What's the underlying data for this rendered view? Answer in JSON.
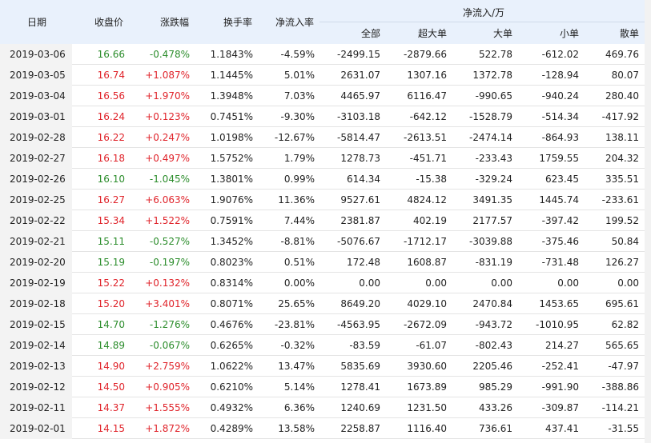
{
  "header": {
    "date": "日期",
    "close": "收盘价",
    "change": "涨跌幅",
    "turnover": "换手率",
    "net_rate": "净流入率",
    "net_group": "净流入/万",
    "all": "全部",
    "xl": "超大单",
    "large": "大单",
    "small": "小单",
    "retail": "散单",
    "sort_icon": "sort-down-arrow-icon"
  },
  "colors": {
    "up": "#e0242b",
    "down": "#2c8d2c",
    "header_bg": "#e9f1fc"
  },
  "rows": [
    {
      "date": "2019-03-06",
      "close": "16.66",
      "chg": "-0.478%",
      "turn": "1.1843%",
      "rate": "-4.59%",
      "all": "-2499.15",
      "xl": "-2879.66",
      "l": "522.78",
      "s": "-612.02",
      "r": "469.76",
      "dir": "down"
    },
    {
      "date": "2019-03-05",
      "close": "16.74",
      "chg": "+1.087%",
      "turn": "1.1445%",
      "rate": "5.01%",
      "all": "2631.07",
      "xl": "1307.16",
      "l": "1372.78",
      "s": "-128.94",
      "r": "80.07",
      "dir": "up"
    },
    {
      "date": "2019-03-04",
      "close": "16.56",
      "chg": "+1.970%",
      "turn": "1.3948%",
      "rate": "7.03%",
      "all": "4465.97",
      "xl": "6116.47",
      "l": "-990.65",
      "s": "-940.24",
      "r": "280.40",
      "dir": "up"
    },
    {
      "date": "2019-03-01",
      "close": "16.24",
      "chg": "+0.123%",
      "turn": "0.7451%",
      "rate": "-9.30%",
      "all": "-3103.18",
      "xl": "-642.12",
      "l": "-1528.79",
      "s": "-514.34",
      "r": "-417.92",
      "dir": "up"
    },
    {
      "date": "2019-02-28",
      "close": "16.22",
      "chg": "+0.247%",
      "turn": "1.0198%",
      "rate": "-12.67%",
      "all": "-5814.47",
      "xl": "-2613.51",
      "l": "-2474.14",
      "s": "-864.93",
      "r": "138.11",
      "dir": "up"
    },
    {
      "date": "2019-02-27",
      "close": "16.18",
      "chg": "+0.497%",
      "turn": "1.5752%",
      "rate": "1.79%",
      "all": "1278.73",
      "xl": "-451.71",
      "l": "-233.43",
      "s": "1759.55",
      "r": "204.32",
      "dir": "up"
    },
    {
      "date": "2019-02-26",
      "close": "16.10",
      "chg": "-1.045%",
      "turn": "1.3801%",
      "rate": "0.99%",
      "all": "614.34",
      "xl": "-15.38",
      "l": "-329.24",
      "s": "623.45",
      "r": "335.51",
      "dir": "down"
    },
    {
      "date": "2019-02-25",
      "close": "16.27",
      "chg": "+6.063%",
      "turn": "1.9076%",
      "rate": "11.36%",
      "all": "9527.61",
      "xl": "4824.12",
      "l": "3491.35",
      "s": "1445.74",
      "r": "-233.61",
      "dir": "up"
    },
    {
      "date": "2019-02-22",
      "close": "15.34",
      "chg": "+1.522%",
      "turn": "0.7591%",
      "rate": "7.44%",
      "all": "2381.87",
      "xl": "402.19",
      "l": "2177.57",
      "s": "-397.42",
      "r": "199.52",
      "dir": "up"
    },
    {
      "date": "2019-02-21",
      "close": "15.11",
      "chg": "-0.527%",
      "turn": "1.3452%",
      "rate": "-8.81%",
      "all": "-5076.67",
      "xl": "-1712.17",
      "l": "-3039.88",
      "s": "-375.46",
      "r": "50.84",
      "dir": "down"
    },
    {
      "date": "2019-02-20",
      "close": "15.19",
      "chg": "-0.197%",
      "turn": "0.8023%",
      "rate": "0.51%",
      "all": "172.48",
      "xl": "1608.87",
      "l": "-831.19",
      "s": "-731.48",
      "r": "126.27",
      "dir": "down"
    },
    {
      "date": "2019-02-19",
      "close": "15.22",
      "chg": "+0.132%",
      "turn": "0.8314%",
      "rate": "0.00%",
      "all": "0.00",
      "xl": "0.00",
      "l": "0.00",
      "s": "0.00",
      "r": "0.00",
      "dir": "up"
    },
    {
      "date": "2019-02-18",
      "close": "15.20",
      "chg": "+3.401%",
      "turn": "0.8071%",
      "rate": "25.65%",
      "all": "8649.20",
      "xl": "4029.10",
      "l": "2470.84",
      "s": "1453.65",
      "r": "695.61",
      "dir": "up"
    },
    {
      "date": "2019-02-15",
      "close": "14.70",
      "chg": "-1.276%",
      "turn": "0.4676%",
      "rate": "-23.81%",
      "all": "-4563.95",
      "xl": "-2672.09",
      "l": "-943.72",
      "s": "-1010.95",
      "r": "62.82",
      "dir": "down"
    },
    {
      "date": "2019-02-14",
      "close": "14.89",
      "chg": "-0.067%",
      "turn": "0.6265%",
      "rate": "-0.32%",
      "all": "-83.59",
      "xl": "-61.07",
      "l": "-802.43",
      "s": "214.27",
      "r": "565.65",
      "dir": "down"
    },
    {
      "date": "2019-02-13",
      "close": "14.90",
      "chg": "+2.759%",
      "turn": "1.0622%",
      "rate": "13.47%",
      "all": "5835.69",
      "xl": "3930.60",
      "l": "2205.46",
      "s": "-252.41",
      "r": "-47.97",
      "dir": "up"
    },
    {
      "date": "2019-02-12",
      "close": "14.50",
      "chg": "+0.905%",
      "turn": "0.6210%",
      "rate": "5.14%",
      "all": "1278.41",
      "xl": "1673.89",
      "l": "985.29",
      "s": "-991.90",
      "r": "-388.86",
      "dir": "up"
    },
    {
      "date": "2019-02-11",
      "close": "14.37",
      "chg": "+1.555%",
      "turn": "0.4932%",
      "rate": "6.36%",
      "all": "1240.69",
      "xl": "1231.50",
      "l": "433.26",
      "s": "-309.87",
      "r": "-114.21",
      "dir": "up"
    },
    {
      "date": "2019-02-01",
      "close": "14.15",
      "chg": "+1.872%",
      "turn": "0.4289%",
      "rate": "13.58%",
      "all": "2258.87",
      "xl": "1116.40",
      "l": "736.61",
      "s": "437.41",
      "r": "-31.55",
      "dir": "up"
    }
  ]
}
